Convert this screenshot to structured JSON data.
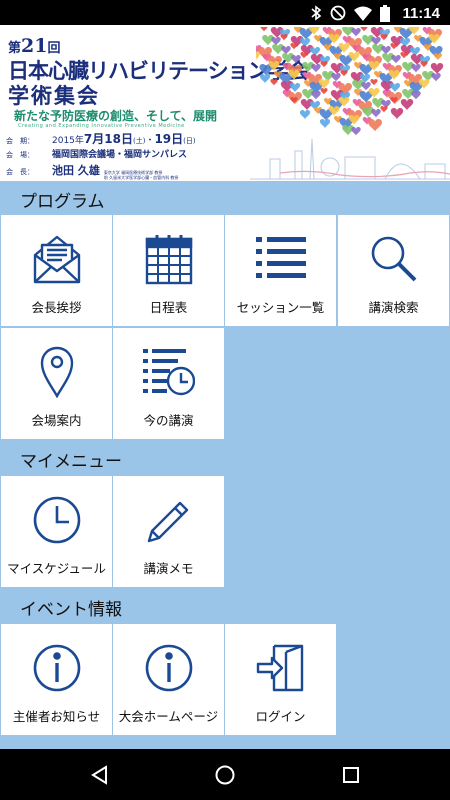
{
  "status_bar": {
    "time": "11:14",
    "icons": [
      "bluetooth-icon",
      "do-not-disturb-icon",
      "wifi-icon",
      "battery-icon"
    ]
  },
  "banner": {
    "edition_prefix": "第",
    "edition_number": "21",
    "edition_suffix": "回",
    "title_line1": "日本心臓リハビリテーション学会",
    "title_line2": "学術集会",
    "subtitle": "新たな予防医療の創造、そして、展開",
    "subtitle_en": "Creating and Expanding Innovative Preventive Medicine",
    "period_label": "会　期：",
    "period_year": "2015年",
    "period_start": "7月18日",
    "period_start_day": "(土)",
    "period_sep": "・",
    "period_end": "19日",
    "period_end_day": "(日)",
    "venue_label": "会　場：",
    "venue": "福岡国際会議場・福岡サンパレス",
    "president_label": "会　長：",
    "president": "池田 久雄",
    "president_aff1": "東京大学 福岡医療技術学部 教授",
    "president_aff2": "前 久留米大学医学部心臓・血管内科 教授"
  },
  "sections": [
    {
      "title": "プログラム",
      "tiles": [
        {
          "label": "会長挨拶",
          "icon": "envelope-letter-icon"
        },
        {
          "label": "日程表",
          "icon": "calendar-icon"
        },
        {
          "label": "セッション一覧",
          "icon": "list-icon"
        },
        {
          "label": "講演検索",
          "icon": "search-icon"
        },
        {
          "label": "会場案内",
          "icon": "map-pin-icon"
        },
        {
          "label": "今の講演",
          "icon": "schedule-clock-icon"
        }
      ]
    },
    {
      "title": "マイメニュー",
      "tiles": [
        {
          "label": "マイスケジュール",
          "icon": "clock-icon"
        },
        {
          "label": "講演メモ",
          "icon": "pencil-icon"
        }
      ]
    },
    {
      "title": "イベント情報",
      "tiles": [
        {
          "label": "主催者お知らせ",
          "icon": "info-icon"
        },
        {
          "label": "大会ホームページ",
          "icon": "info-icon"
        },
        {
          "label": "ログイン",
          "icon": "login-icon"
        }
      ]
    }
  ],
  "navbar": {
    "icons": [
      "back-icon",
      "home-icon",
      "recents-icon"
    ]
  },
  "colors": {
    "accent": "#1b4a93",
    "background": "#9ac4e8",
    "tile": "#ffffff",
    "banner_text": "#1b2f7c"
  }
}
